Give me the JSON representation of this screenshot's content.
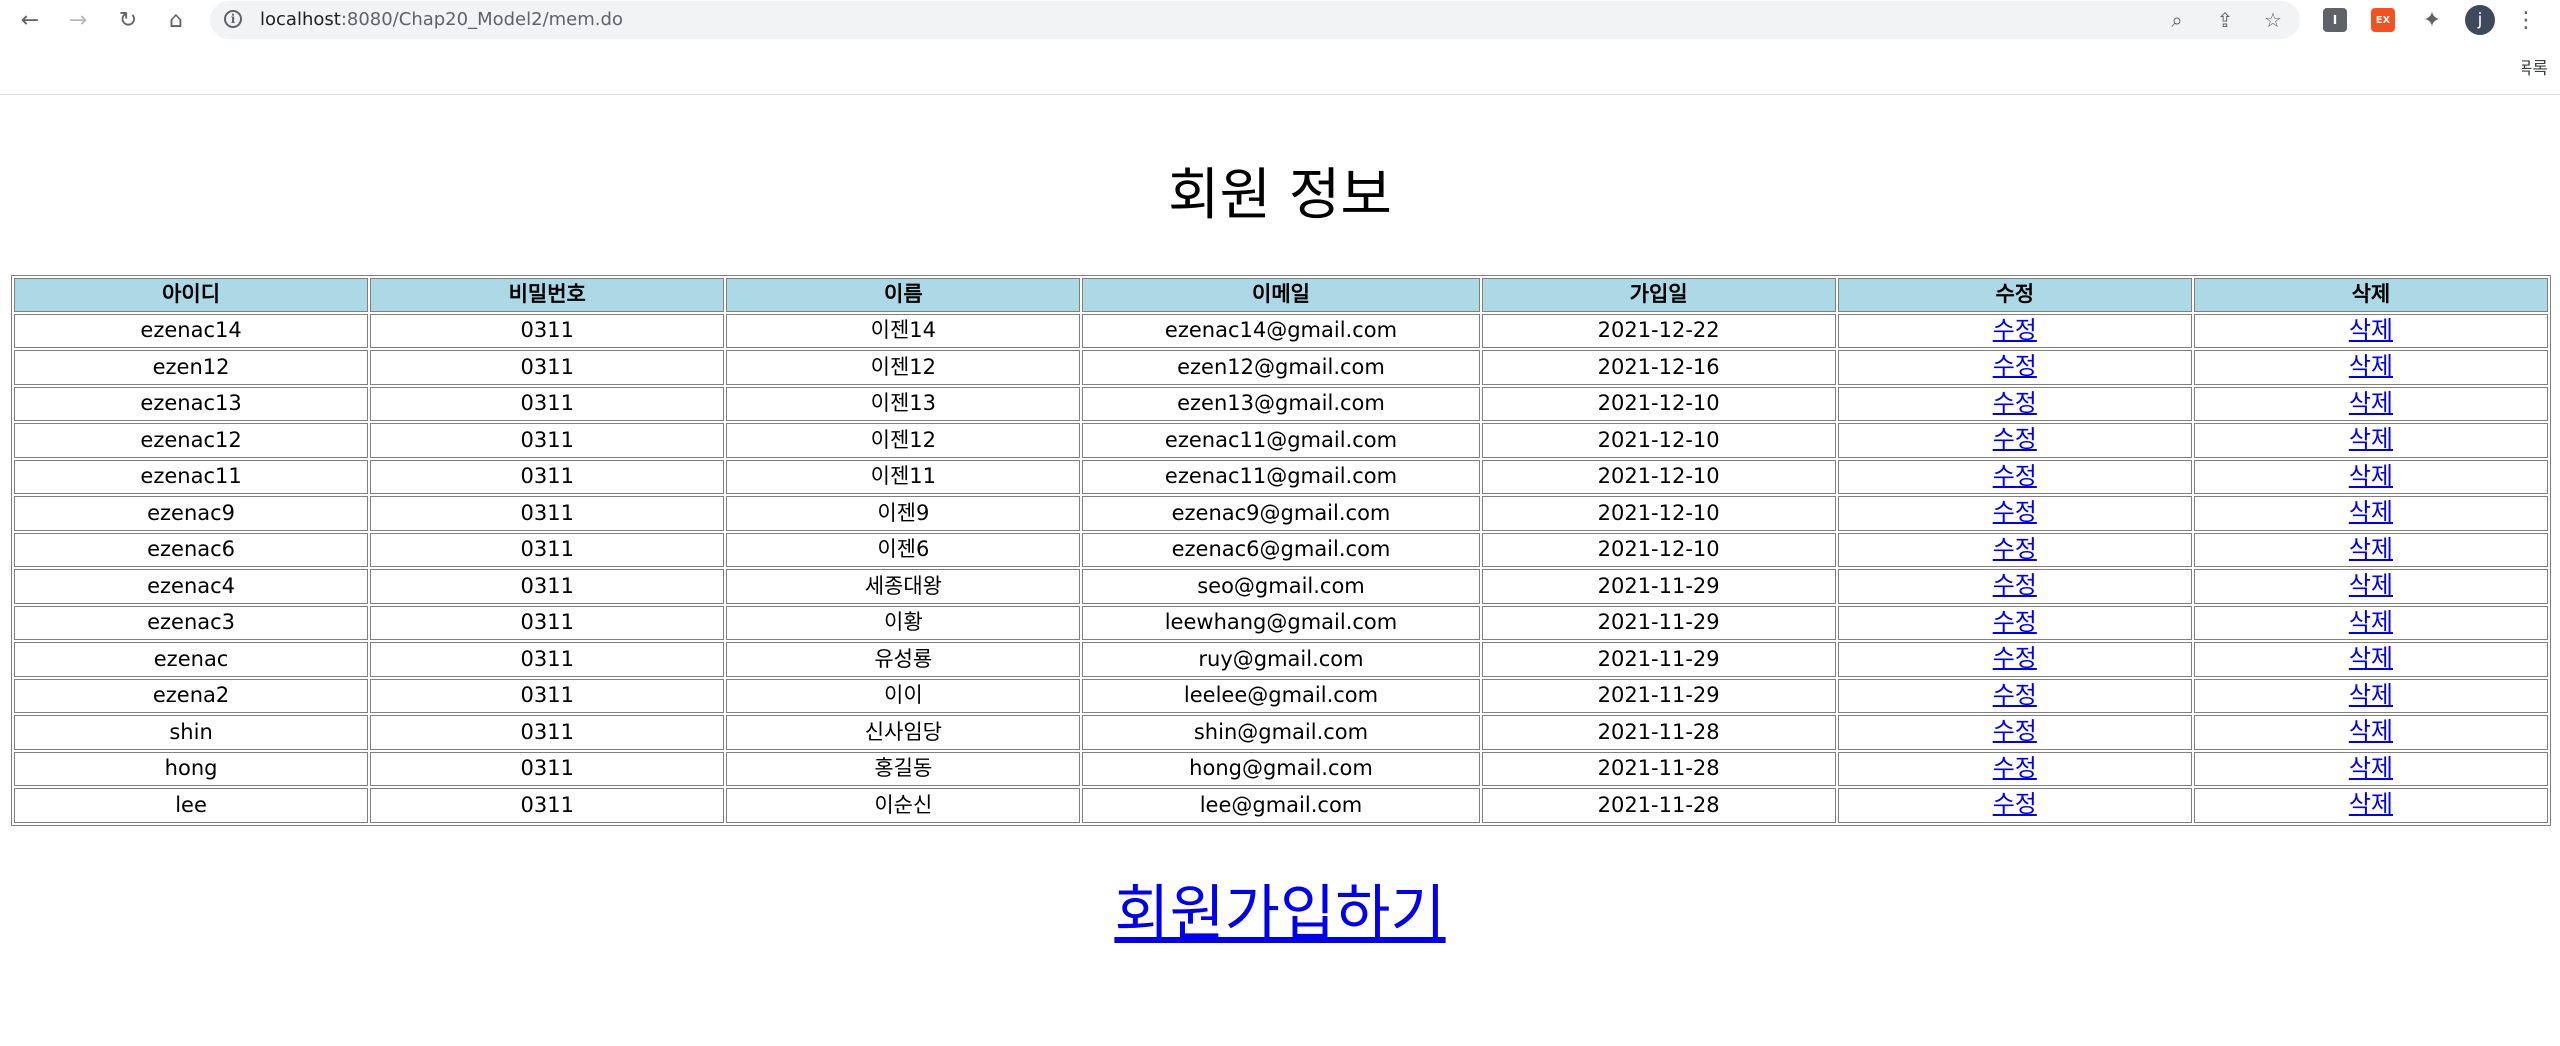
{
  "browser": {
    "back_icon": "←",
    "forward_icon": "→",
    "reload_icon": "↻",
    "home_icon": "⌂",
    "url_host": "localhost",
    "url_rest": ":8080/Chap20_Model2/mem.do",
    "info_icon": "i",
    "zoom_icon": "⌕",
    "share_icon": "⇪",
    "star_icon": "☆",
    "ext1_label": "I",
    "ext2_label": "EX",
    "puzzle_icon": "✦",
    "avatar_initial": "j",
    "menu_icon": "⋮",
    "bookmark_partial": "북마크 목록",
    "colors": {
      "ext1": "#5f6368",
      "ext2": "#f4511e",
      "avatar": "#3c4a5c"
    }
  },
  "page": {
    "title": "회원 정보",
    "header_color": "#add8e6",
    "columns": [
      "아이디",
      "비밀번호",
      "이름",
      "이메일",
      "가입일",
      "수정",
      "삭제"
    ],
    "rows": [
      {
        "id": "ezenac14",
        "pwd": "0311",
        "name": "이젠14",
        "email": "ezenac14@gmail.com",
        "date": "2021-12-22",
        "edit": "수정",
        "del": "삭제"
      },
      {
        "id": "ezen12",
        "pwd": "0311",
        "name": "이젠12",
        "email": "ezen12@gmail.com",
        "date": "2021-12-16",
        "edit": "수정",
        "del": "삭제"
      },
      {
        "id": "ezenac13",
        "pwd": "0311",
        "name": "이젠13",
        "email": "ezen13@gmail.com",
        "date": "2021-12-10",
        "edit": "수정",
        "del": "삭제"
      },
      {
        "id": "ezenac12",
        "pwd": "0311",
        "name": "이젠12",
        "email": "ezenac11@gmail.com",
        "date": "2021-12-10",
        "edit": "수정",
        "del": "삭제"
      },
      {
        "id": "ezenac11",
        "pwd": "0311",
        "name": "이젠11",
        "email": "ezenac11@gmail.com",
        "date": "2021-12-10",
        "edit": "수정",
        "del": "삭제"
      },
      {
        "id": "ezenac9",
        "pwd": "0311",
        "name": "이젠9",
        "email": "ezenac9@gmail.com",
        "date": "2021-12-10",
        "edit": "수정",
        "del": "삭제"
      },
      {
        "id": "ezenac6",
        "pwd": "0311",
        "name": "이젠6",
        "email": "ezenac6@gmail.com",
        "date": "2021-12-10",
        "edit": "수정",
        "del": "삭제"
      },
      {
        "id": "ezenac4",
        "pwd": "0311",
        "name": "세종대왕",
        "email": "seo@gmail.com",
        "date": "2021-11-29",
        "edit": "수정",
        "del": "삭제"
      },
      {
        "id": "ezenac3",
        "pwd": "0311",
        "name": "이황",
        "email": "leewhang@gmail.com",
        "date": "2021-11-29",
        "edit": "수정",
        "del": "삭제"
      },
      {
        "id": "ezenac",
        "pwd": "0311",
        "name": "유성룡",
        "email": "ruy@gmail.com",
        "date": "2021-11-29",
        "edit": "수정",
        "del": "삭제"
      },
      {
        "id": "ezena2",
        "pwd": "0311",
        "name": "이이",
        "email": "leelee@gmail.com",
        "date": "2021-11-29",
        "edit": "수정",
        "del": "삭제"
      },
      {
        "id": "shin",
        "pwd": "0311",
        "name": "신사임당",
        "email": "shin@gmail.com",
        "date": "2021-11-28",
        "edit": "수정",
        "del": "삭제"
      },
      {
        "id": "hong",
        "pwd": "0311",
        "name": "홍길동",
        "email": "hong@gmail.com",
        "date": "2021-11-28",
        "edit": "수정",
        "del": "삭제"
      },
      {
        "id": "lee",
        "pwd": "0311",
        "name": "이순신",
        "email": "lee@gmail.com",
        "date": "2021-11-28",
        "edit": "수정",
        "del": "삭제"
      }
    ],
    "join_link": "회원가입하기"
  }
}
